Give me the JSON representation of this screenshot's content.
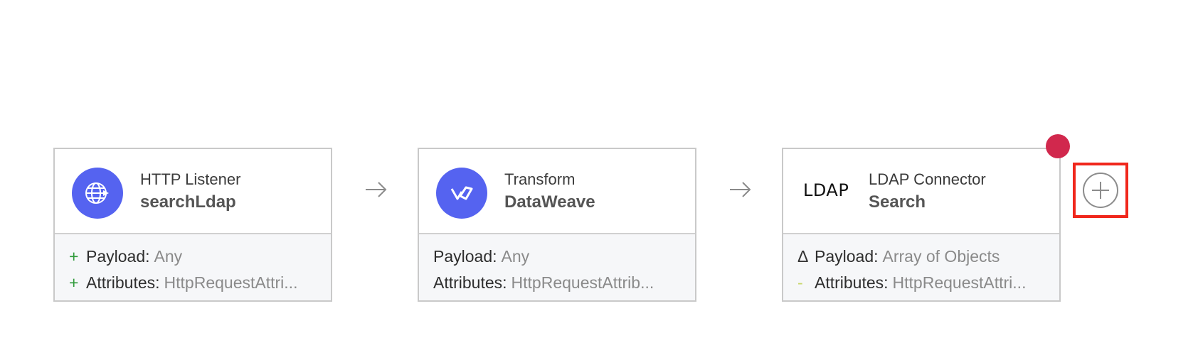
{
  "flow": {
    "components": [
      {
        "type": "HTTP Listener",
        "name": "searchLdap",
        "icon": "globe-icon",
        "icon_color": "#5563f0",
        "rows": [
          {
            "marker": "+",
            "key": "Payload:",
            "value": "Any"
          },
          {
            "marker": "+",
            "key": "Attributes:",
            "value": "HttpRequestAttri..."
          }
        ]
      },
      {
        "type": "Transform",
        "name": "DataWeave",
        "icon": "dataweave-icon",
        "icon_color": "#5563f0",
        "rows": [
          {
            "marker": "",
            "key": "Payload:",
            "value": "Any"
          },
          {
            "marker": "",
            "key": "Attributes:",
            "value": "HttpRequestAttrib..."
          }
        ]
      },
      {
        "type": "LDAP Connector",
        "name": "Search",
        "icon_text": "LDAP",
        "rows": [
          {
            "marker": "Δ",
            "key": "Payload:",
            "value": "Array of Objects"
          },
          {
            "marker": "-",
            "key": "Attributes:",
            "value": "HttpRequestAttri..."
          }
        ]
      }
    ],
    "error_color": "#d1284d",
    "highlight_color": "#f0271c"
  }
}
